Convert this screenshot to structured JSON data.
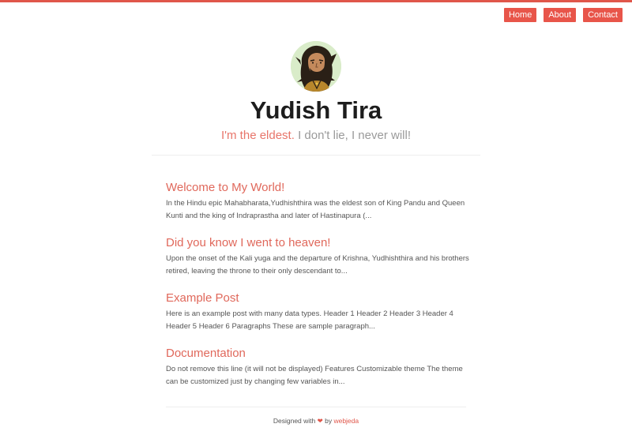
{
  "nav": {
    "items": [
      {
        "label": "Home"
      },
      {
        "label": "About"
      },
      {
        "label": "Contact"
      }
    ]
  },
  "header": {
    "title": "Yudish Tira",
    "tagline_accent": "I'm the eldest.",
    "tagline_rest": " I don't lie, I never will!"
  },
  "posts": [
    {
      "title": "Welcome to My World!",
      "excerpt": "In the Hindu epic Mahabharata,Yudhishthira was the eldest son of King Pandu and Queen Kunti and the king of Indraprastha and later of Hastinapura (..."
    },
    {
      "title": "Did you know I went to heaven!",
      "excerpt": "Upon the onset of the Kali yuga and the departure of Krishna, Yudhishthira and his brothers retired, leaving the throne to their only descendant to..."
    },
    {
      "title": "Example Post",
      "excerpt": "Here is an example post with many data types. Header 1 Header 2 Header 3 Header 4 Header 5 Header 6 Paragraphs These are sample paragraph..."
    },
    {
      "title": "Documentation",
      "excerpt": "Do not remove this line (it will not be displayed) Features Customizable theme The theme can be customized just by changing few variables in..."
    }
  ],
  "footer": {
    "prefix": "Designed with ",
    "heart": "❤",
    "by": " by ",
    "link": "webjeda"
  },
  "colors": {
    "accent": "#e8554a",
    "link": "#e0685b",
    "tagline_muted": "#9a9a9a"
  },
  "icons": {
    "avatar": "warrior-portrait-avatar",
    "heart": "heart-icon"
  }
}
